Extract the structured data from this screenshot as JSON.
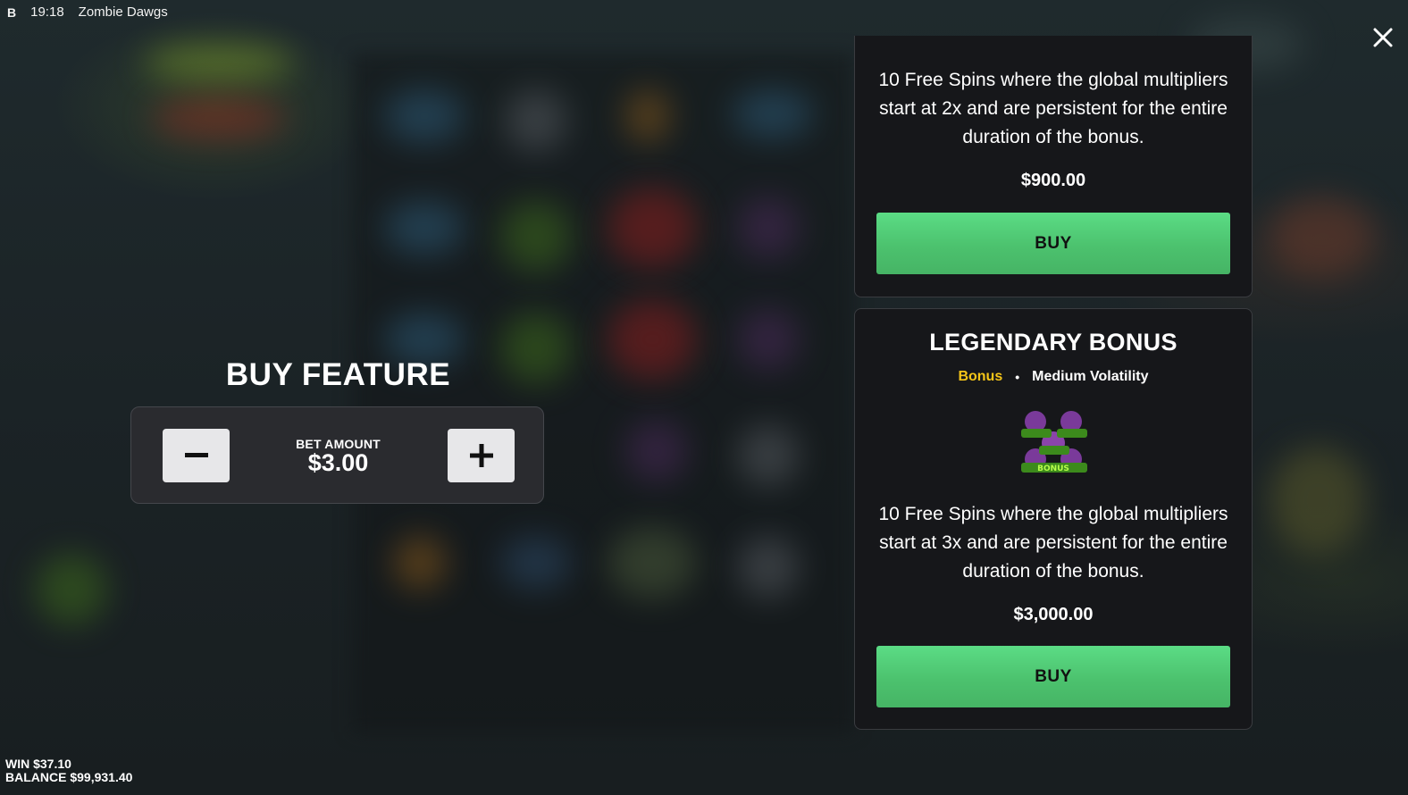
{
  "status_bar": {
    "brand": "B",
    "time": "19:18",
    "game_title": "Zombie Dawgs"
  },
  "close_icon": "close-icon",
  "buy_feature": {
    "title": "BUY FEATURE",
    "bet_label": "BET AMOUNT",
    "bet_value": "$3.00",
    "decrease_icon": "minus-icon",
    "increase_icon": "plus-icon"
  },
  "cards": [
    {
      "description": "10 Free Spins where the global multipliers start at 2x and are persistent for the entire duration of the bonus.",
      "price": "$900.00",
      "buy_label": "BUY"
    },
    {
      "title": "LEGENDARY BONUS",
      "type": "Bonus",
      "separator": "•",
      "volatility": "Medium Volatility",
      "art_text": "BONUS",
      "description": "10 Free Spins where the global multipliers start at 3x and are persistent for the entire duration of the bonus.",
      "price": "$3,000.00",
      "buy_label": "BUY"
    }
  ],
  "bottom": {
    "win_label": "WIN",
    "win_value": "$37.10",
    "balance_label": "BALANCE",
    "balance_value": "$99,931.40"
  },
  "colors": {
    "buy_button": "#4cc26e",
    "bonus_tag": "#f5c518",
    "card_bg": "#16171a",
    "bet_box_bg": "#2a2b2f"
  }
}
